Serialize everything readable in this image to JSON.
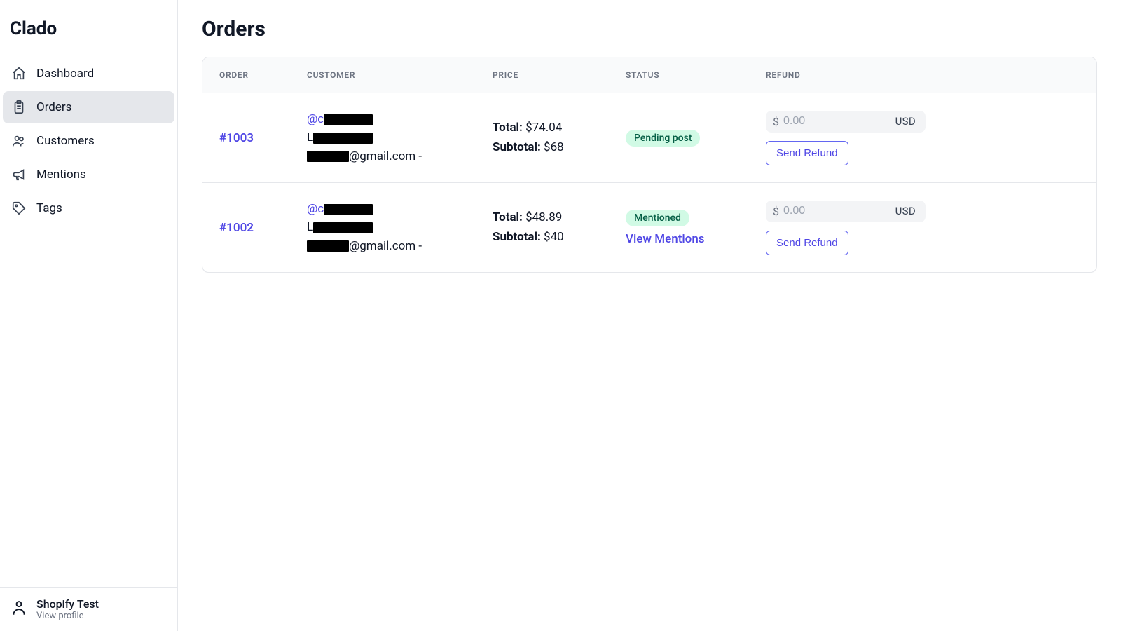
{
  "brand": "Clado",
  "sidebar": {
    "items": [
      {
        "label": "Dashboard",
        "active": false
      },
      {
        "label": "Orders",
        "active": true
      },
      {
        "label": "Customers",
        "active": false
      },
      {
        "label": "Mentions",
        "active": false
      },
      {
        "label": "Tags",
        "active": false
      }
    ],
    "footer": {
      "name": "Shopify Test",
      "sub": "View profile"
    }
  },
  "page": {
    "title": "Orders"
  },
  "table": {
    "headers": {
      "order": "ORDER",
      "customer": "CUSTOMER",
      "price": "PRICE",
      "status": "STATUS",
      "refund": "REFUND"
    },
    "rows": [
      {
        "order_id": "#1003",
        "customer_handle_prefix": "@c",
        "customer_name_prefix": "L",
        "customer_email_suffix": "@gmail.com -",
        "total_label": "Total:",
        "total_value": "$74.04",
        "sub_label": "Subtotal:",
        "sub_value": "$68",
        "status_badge": "Pending post",
        "has_view_mentions": false,
        "refund_placeholder": "0.00",
        "refund_currency": "USD",
        "send_label": "Send Refund"
      },
      {
        "order_id": "#1002",
        "customer_handle_prefix": "@c",
        "customer_name_prefix": "L",
        "customer_email_suffix": "@gmail.com -",
        "total_label": "Total:",
        "total_value": "$48.89",
        "sub_label": "Subtotal:",
        "sub_value": "$40",
        "status_badge": "Mentioned",
        "has_view_mentions": true,
        "view_mentions_label": "View Mentions",
        "refund_placeholder": "0.00",
        "refund_currency": "USD",
        "send_label": "Send Refund"
      }
    ]
  },
  "misc": {
    "dollar_sign": "$"
  }
}
